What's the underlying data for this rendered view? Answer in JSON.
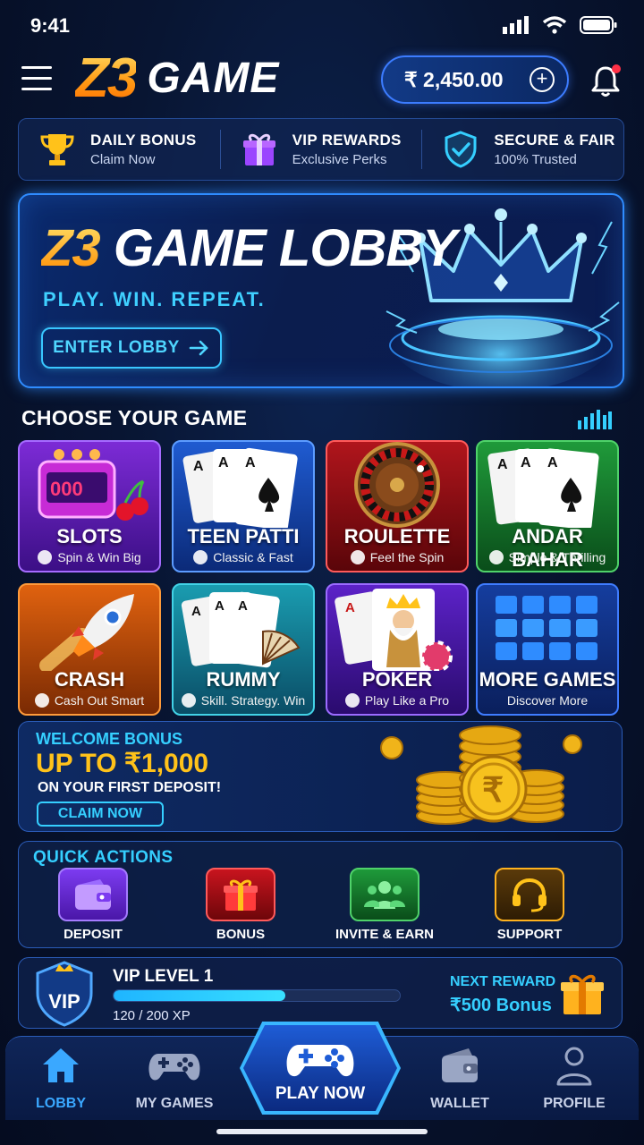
{
  "status": {
    "time": "9:41"
  },
  "header": {
    "logo_z3": "Z3",
    "logo_game": "GAME",
    "balance": "₹ 2,450.00"
  },
  "features": [
    {
      "title": "DAILY BONUS",
      "subtitle": "Claim Now",
      "icon": "trophy-icon"
    },
    {
      "title": "VIP REWARDS",
      "subtitle": "Exclusive Perks",
      "icon": "gift-icon"
    },
    {
      "title": "SECURE & FAIR",
      "subtitle": "100% Trusted",
      "icon": "shield-check-icon"
    }
  ],
  "hero": {
    "title_z3": "Z3",
    "title_rest": "GAME LOBBY",
    "tagline": "PLAY. WIN. REPEAT.",
    "cta": "ENTER LOBBY"
  },
  "games_section": {
    "title": "CHOOSE YOUR GAME"
  },
  "games": [
    {
      "name": "SLOTS",
      "subtitle": "Spin & Win Big"
    },
    {
      "name": "TEEN PATTI",
      "subtitle": "Classic & Fast"
    },
    {
      "name": "ROULETTE",
      "subtitle": "Feel the Spin"
    },
    {
      "name": "ANDAR BAHAR",
      "subtitle": "Simple & Thrilling"
    },
    {
      "name": "CRASH",
      "subtitle": "Cash Out Smart"
    },
    {
      "name": "RUMMY",
      "subtitle": "Skill. Strategy. Win"
    },
    {
      "name": "POKER",
      "subtitle": "Play Like a Pro"
    },
    {
      "name": "MORE GAMES",
      "subtitle": "Discover More"
    }
  ],
  "welcome_bonus": {
    "kicker": "WELCOME BONUS",
    "amount": "UP TO ₹1,000",
    "note": "ON YOUR FIRST DEPOSIT!",
    "cta": "CLAIM NOW"
  },
  "quick_actions": {
    "title": "QUICK ACTIONS",
    "items": [
      {
        "label": "DEPOSIT",
        "icon": "wallet-icon"
      },
      {
        "label": "BONUS",
        "icon": "gift-icon"
      },
      {
        "label": "INVITE & EARN",
        "icon": "users-icon"
      },
      {
        "label": "SUPPORT",
        "icon": "headset-icon"
      }
    ]
  },
  "vip": {
    "badge": "VIP",
    "level": "VIP LEVEL 1",
    "xp_text": "120 / 200 XP",
    "xp_fraction": 0.6,
    "next_label": "NEXT REWARD",
    "next_value": "₹500 Bonus"
  },
  "nav": {
    "items": [
      {
        "label": "LOBBY",
        "icon": "home-icon",
        "active": true
      },
      {
        "label": "MY GAMES",
        "icon": "gamepad-icon"
      },
      {
        "label": "PLAY NOW",
        "icon": "gamepad-icon"
      },
      {
        "label": "WALLET",
        "icon": "wallet-icon"
      },
      {
        "label": "PROFILE",
        "icon": "user-icon"
      }
    ]
  },
  "colors": {
    "accent_cyan": "#35cfff",
    "gold": "#ffc21a",
    "brand_blue": "#2f8cff",
    "active_nav": "#3aa8ff"
  }
}
